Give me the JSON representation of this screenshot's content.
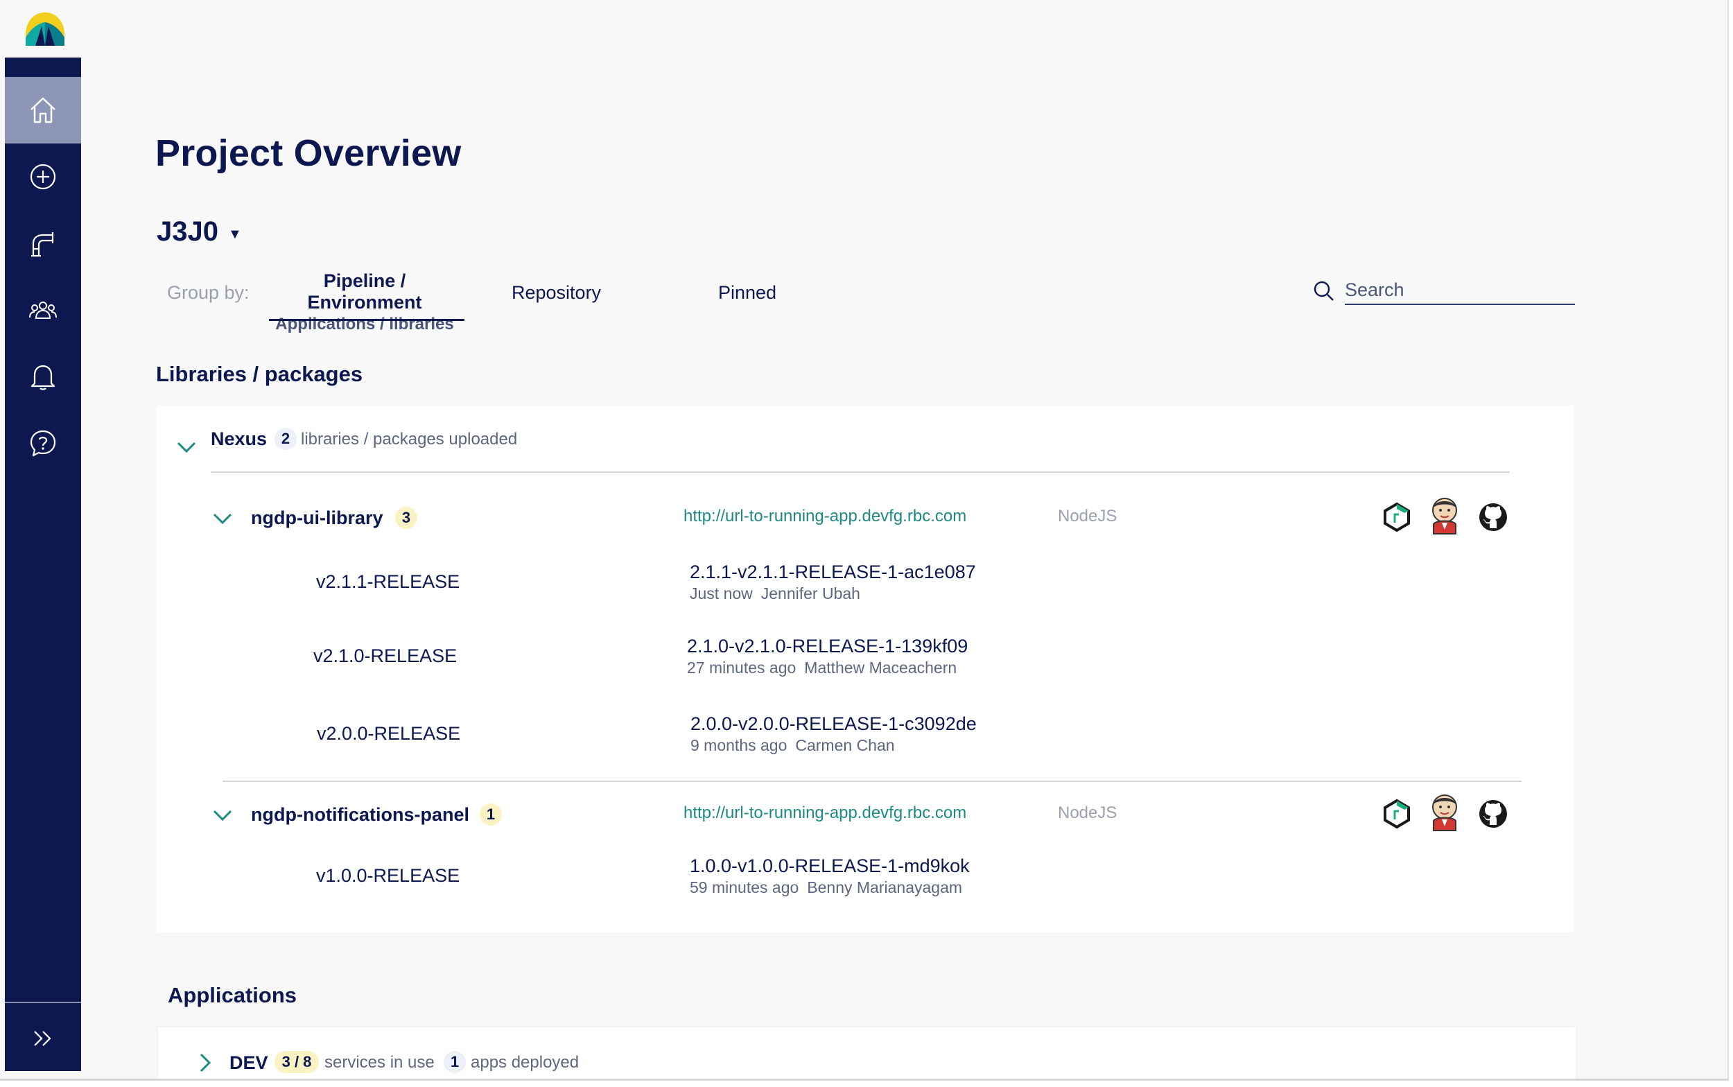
{
  "page": {
    "title": "Project Overview",
    "project_code": "J3J0"
  },
  "colors": {
    "navy": "#0d1850",
    "sidebar_active": "#8e96b8",
    "link_teal": "#1d8a82",
    "badge_yellow": "#fbf2c4",
    "badge_blue": "#edf0f8"
  },
  "sidebar": {
    "items": [
      {
        "icon": "home-icon",
        "active": true
      },
      {
        "icon": "plus-circle-icon",
        "active": false
      },
      {
        "icon": "pipeline-icon",
        "active": false
      },
      {
        "icon": "team-icon",
        "active": false
      },
      {
        "icon": "bell-icon",
        "active": false
      },
      {
        "icon": "help-icon",
        "active": false
      }
    ],
    "expand_icon": "double-chevron-right-icon"
  },
  "group_by": {
    "label": "Group by:",
    "tabs": [
      {
        "line1": "Pipeline / Environment",
        "line2": "Applications / libraries",
        "active": true
      },
      {
        "label": "Repository",
        "active": false
      },
      {
        "label": "Pinned",
        "active": false
      }
    ]
  },
  "search": {
    "placeholder": "Search"
  },
  "libraries": {
    "section_title": "Libraries / packages",
    "nexus": {
      "name": "Nexus",
      "count": "2",
      "text": "libraries / packages uploaded"
    },
    "items": [
      {
        "name": "ngdp-ui-library",
        "count": "3",
        "url": "http://url-to-running-app.devfg.rbc.com",
        "tech": "NodeJS",
        "versions": [
          {
            "version": "v2.1.1-RELEASE",
            "release": "2.1.1-v2.1.1-RELEASE-1-ac1e087",
            "time": "Just now",
            "author": "Jennifer Ubah"
          },
          {
            "version": "v2.1.0-RELEASE",
            "release": "2.1.0-v2.1.0-RELEASE-1-139kf09",
            "time": "27 minutes ago",
            "author": "Matthew Maceachern"
          },
          {
            "version": "v2.0.0-RELEASE",
            "release": "2.0.0-v2.0.0-RELEASE-1-c3092de",
            "time": "9 months ago",
            "author": "Carmen Chan"
          }
        ]
      },
      {
        "name": "ngdp-notifications-panel",
        "count": "1",
        "url": "http://url-to-running-app.devfg.rbc.com",
        "tech": "NodeJS",
        "versions": [
          {
            "version": "v1.0.0-RELEASE",
            "release": "1.0.0-v1.0.0-RELEASE-1-md9kok",
            "time": "59 minutes ago",
            "author": "Benny Marianayagam"
          }
        ]
      }
    ]
  },
  "applications": {
    "section_title": "Applications",
    "env": {
      "name": "DEV",
      "services": "3 / 8",
      "services_text": "services in use",
      "apps": "1",
      "apps_text": "apps deployed"
    }
  }
}
